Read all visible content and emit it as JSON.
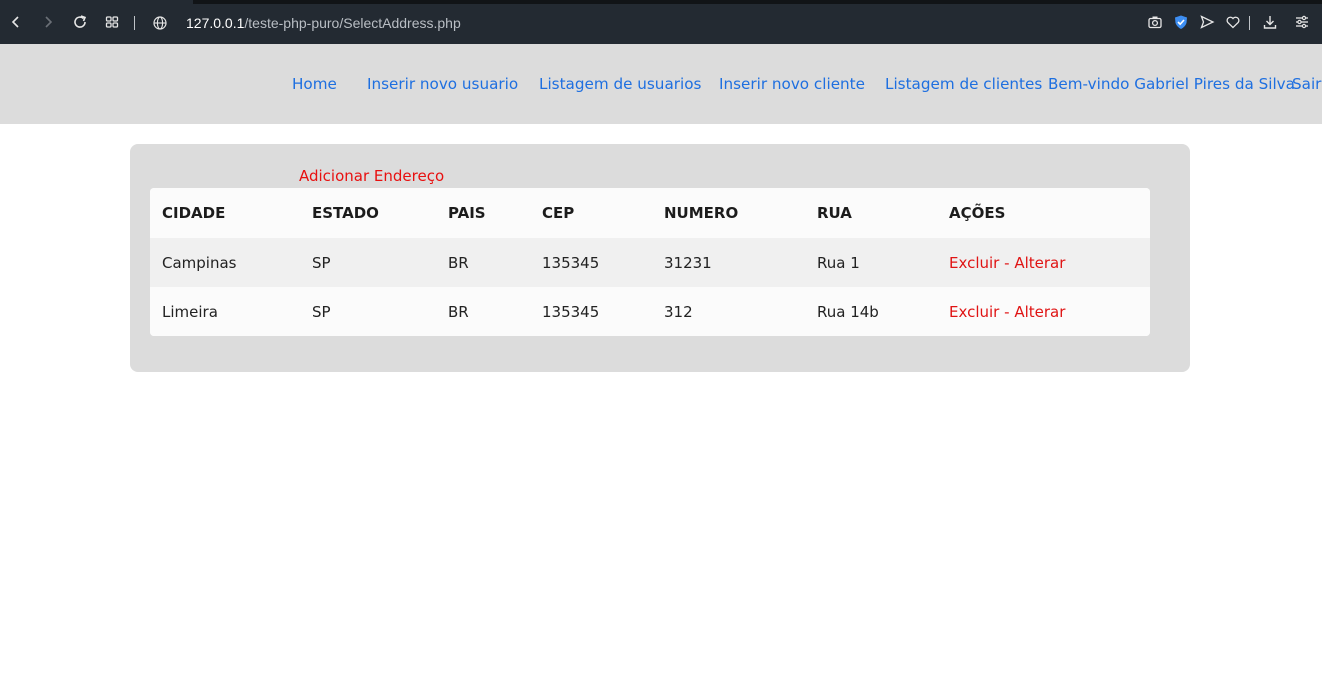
{
  "browser": {
    "url_host": "127.0.0.1",
    "url_path": "/teste-php-puro/SelectAddress.php",
    "icons": [
      "back-icon",
      "forward-icon",
      "reload-icon",
      "tabs-grid-icon",
      "globe-icon",
      "camera-icon",
      "shield-icon",
      "send-icon",
      "heart-icon",
      "download-icon",
      "menu-icon"
    ]
  },
  "nav": {
    "home": "Home",
    "insert_user": "Inserir novo usuario",
    "list_users": "Listagem de usuarios",
    "insert_client": "Inserir novo cliente",
    "list_clients": "Listagem de clientes",
    "welcome": "Bem-vindo Gabriel Pires da Silva",
    "logout": "Sair"
  },
  "page": {
    "add_address": "Adicionar Endereço"
  },
  "table": {
    "headers": [
      "CIDADE",
      "ESTADO",
      "PAIS",
      "CEP",
      "NUMERO",
      "RUA",
      "AÇÕES"
    ],
    "rows": [
      {
        "cidade": "Campinas",
        "estado": "SP",
        "pais": "BR",
        "cep": "135345",
        "numero": "31231",
        "rua": "Rua 1",
        "excluir": "Excluir",
        "dash": " - ",
        "alterar": "Alterar"
      },
      {
        "cidade": "Limeira",
        "estado": "SP",
        "pais": "BR",
        "cep": "135345",
        "numero": "312",
        "rua": "Rua 14b",
        "excluir": "Excluir",
        "dash": " - ",
        "alterar": "Alterar"
      }
    ]
  },
  "colors": {
    "link_blue": "#1e6fe0",
    "action_red": "#e01414",
    "nav_bg": "#dcdcdc",
    "browser_bg": "#232a32"
  }
}
